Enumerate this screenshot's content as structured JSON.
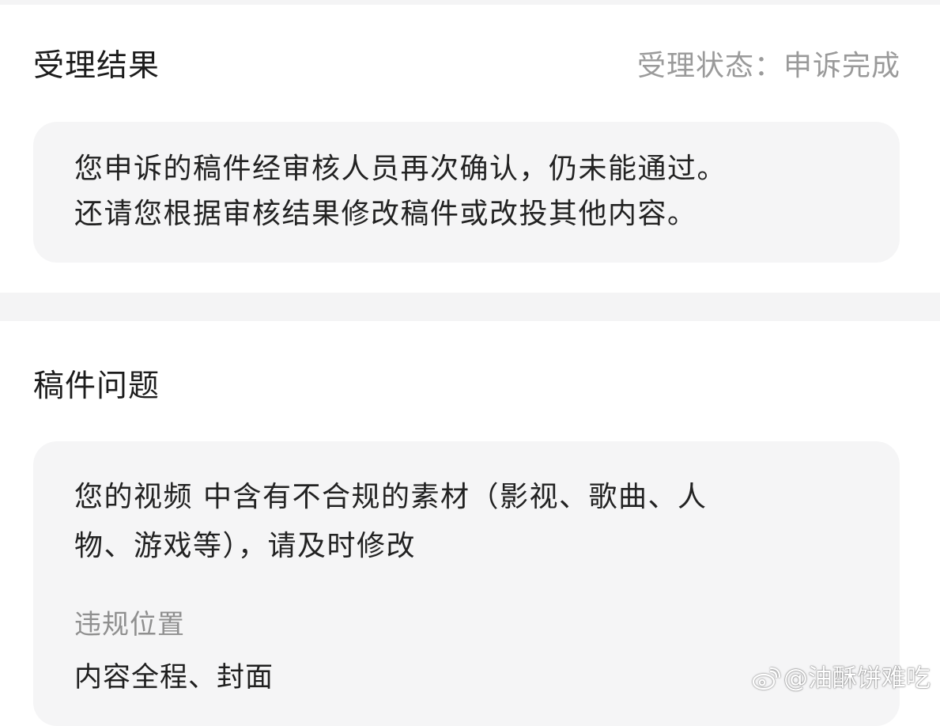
{
  "result_section": {
    "title": "受理结果",
    "status": "受理状态：申诉完成",
    "message_lines": [
      "您申诉的稿件经审核人员再次确认，仍未能通过。",
      "还请您根据审核结果修改稿件或改投其他内容。"
    ]
  },
  "issue_section": {
    "title": "稿件问题",
    "message_lines": [
      "您的视频 中含有不合规的素材（影视、歌曲、人",
      "物、游戏等），请及时修改"
    ],
    "violation_label": "违规位置",
    "violation_value": "内容全程、封面"
  },
  "watermark": {
    "icon": "weibo-logo-icon",
    "text": "@油酥饼难吃"
  },
  "colors": {
    "background": "#ffffff",
    "card": "#f5f5f6",
    "divider": "#f4f4f5",
    "muted_text": "#9a9a9a",
    "body_text": "#222222"
  }
}
